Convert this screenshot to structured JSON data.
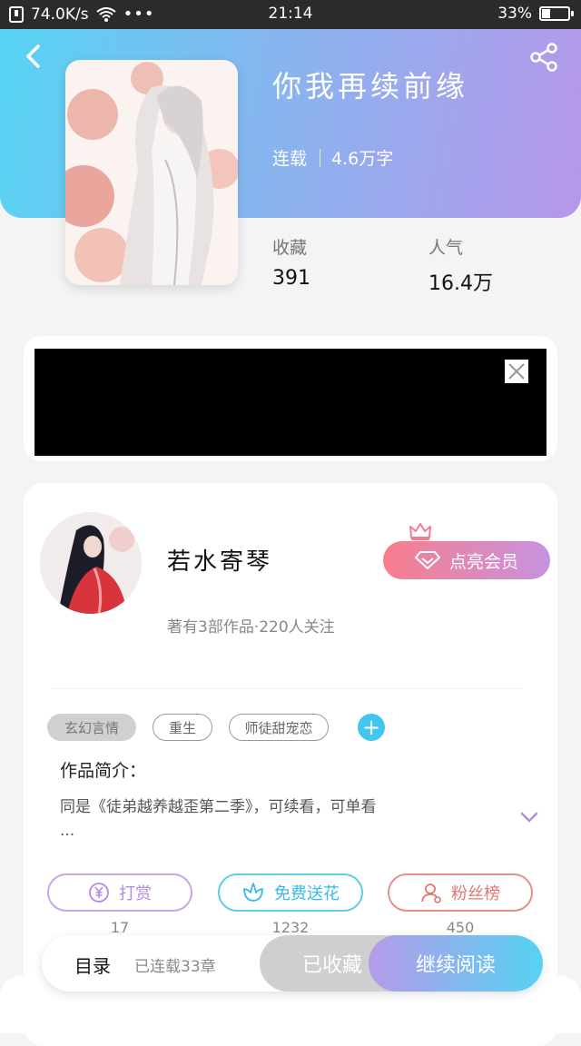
{
  "status_bar": {
    "speed": "74.0K/s",
    "time": "21:14",
    "battery": "33%",
    "battery_level": 0.33
  },
  "book": {
    "title": "你我再续前缘",
    "status": "连载",
    "word_count": "4.6万字",
    "favorites_label": "收藏",
    "favorites_value": "391",
    "popularity_label": "人气",
    "popularity_value": "16.4万"
  },
  "author": {
    "name": "若水寄琴",
    "summary": "著有3部作品·220人关注",
    "vip_button": "点亮会员"
  },
  "tags": [
    "玄幻言情",
    "重生",
    "师徒甜宠恋"
  ],
  "intro": {
    "title": "作品简介：",
    "text": "同是《徒弟越养越歪第二季》，可续看，可单看",
    "ellipsis": "..."
  },
  "actions": {
    "reward_label": "打赏",
    "reward_count": "17",
    "flower_label": "免费送花",
    "flower_count": "1232",
    "fans_label": "粉丝榜",
    "fans_count": "450"
  },
  "bottom_bar": {
    "toc_label": "目录",
    "toc_status": "已连载33章",
    "collected_label": "已收藏",
    "continue_label": "继续阅读"
  },
  "icons": {
    "back": "chevron-left-icon",
    "share": "share-icon",
    "vip": "diamond-icon",
    "crown": "crown-icon",
    "add": "plus-icon",
    "expand": "chevron-down-icon",
    "reward": "yen-coin-icon",
    "flower": "flower-icon",
    "fans": "user-icon",
    "close": "close-icon"
  },
  "colors": {
    "gradient_start": "#56d4f3",
    "gradient_end": "#b796ea",
    "accent_blue": "#42c5ee",
    "accent_purple": "#b78ae0",
    "accent_red": "#e17771"
  }
}
